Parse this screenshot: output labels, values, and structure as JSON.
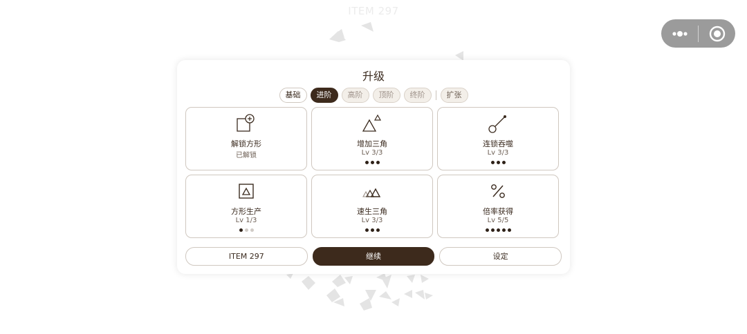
{
  "background": {
    "title": "ITEM 297"
  },
  "capsule": {
    "more_icon": "more-dots-icon",
    "close_icon": "target-circle-icon"
  },
  "panel": {
    "title": "升级",
    "tabs": [
      {
        "label": "基础",
        "state": "normal"
      },
      {
        "label": "进阶",
        "state": "active"
      },
      {
        "label": "高阶",
        "state": "locked"
      },
      {
        "label": "顶阶",
        "state": "locked"
      },
      {
        "label": "终阶",
        "state": "locked"
      },
      {
        "label": "扩张",
        "state": "ext"
      }
    ],
    "upgrades": [
      {
        "name": "解锁方形",
        "level": "已解锁",
        "icon": "square-plus-icon",
        "dots_filled": 0,
        "dots_total": 0
      },
      {
        "name": "增加三角",
        "level": "Lv 3/3",
        "icon": "triangle-pair-icon",
        "dots_filled": 3,
        "dots_total": 3
      },
      {
        "name": "连锁吞噬",
        "level": "Lv 3/3",
        "icon": "chain-link-icon",
        "dots_filled": 3,
        "dots_total": 3
      },
      {
        "name": "方形生产",
        "level": "Lv 1/3",
        "icon": "square-triangle-icon",
        "dots_filled": 1,
        "dots_total": 3
      },
      {
        "name": "速生三角",
        "level": "Lv 3/3",
        "icon": "triangle-speed-icon",
        "dots_filled": 3,
        "dots_total": 3
      },
      {
        "name": "倍率获得",
        "level": "Lv 5/5",
        "icon": "percent-icon",
        "dots_filled": 5,
        "dots_total": 5
      }
    ],
    "buttons": {
      "item": "ITEM 297",
      "continue": "继续",
      "settings": "设定"
    }
  },
  "colors": {
    "accent": "#3d2a1c",
    "border": "#cfc7bf",
    "locked_bg": "#f3efe9",
    "shard": "#e6e6e6"
  }
}
